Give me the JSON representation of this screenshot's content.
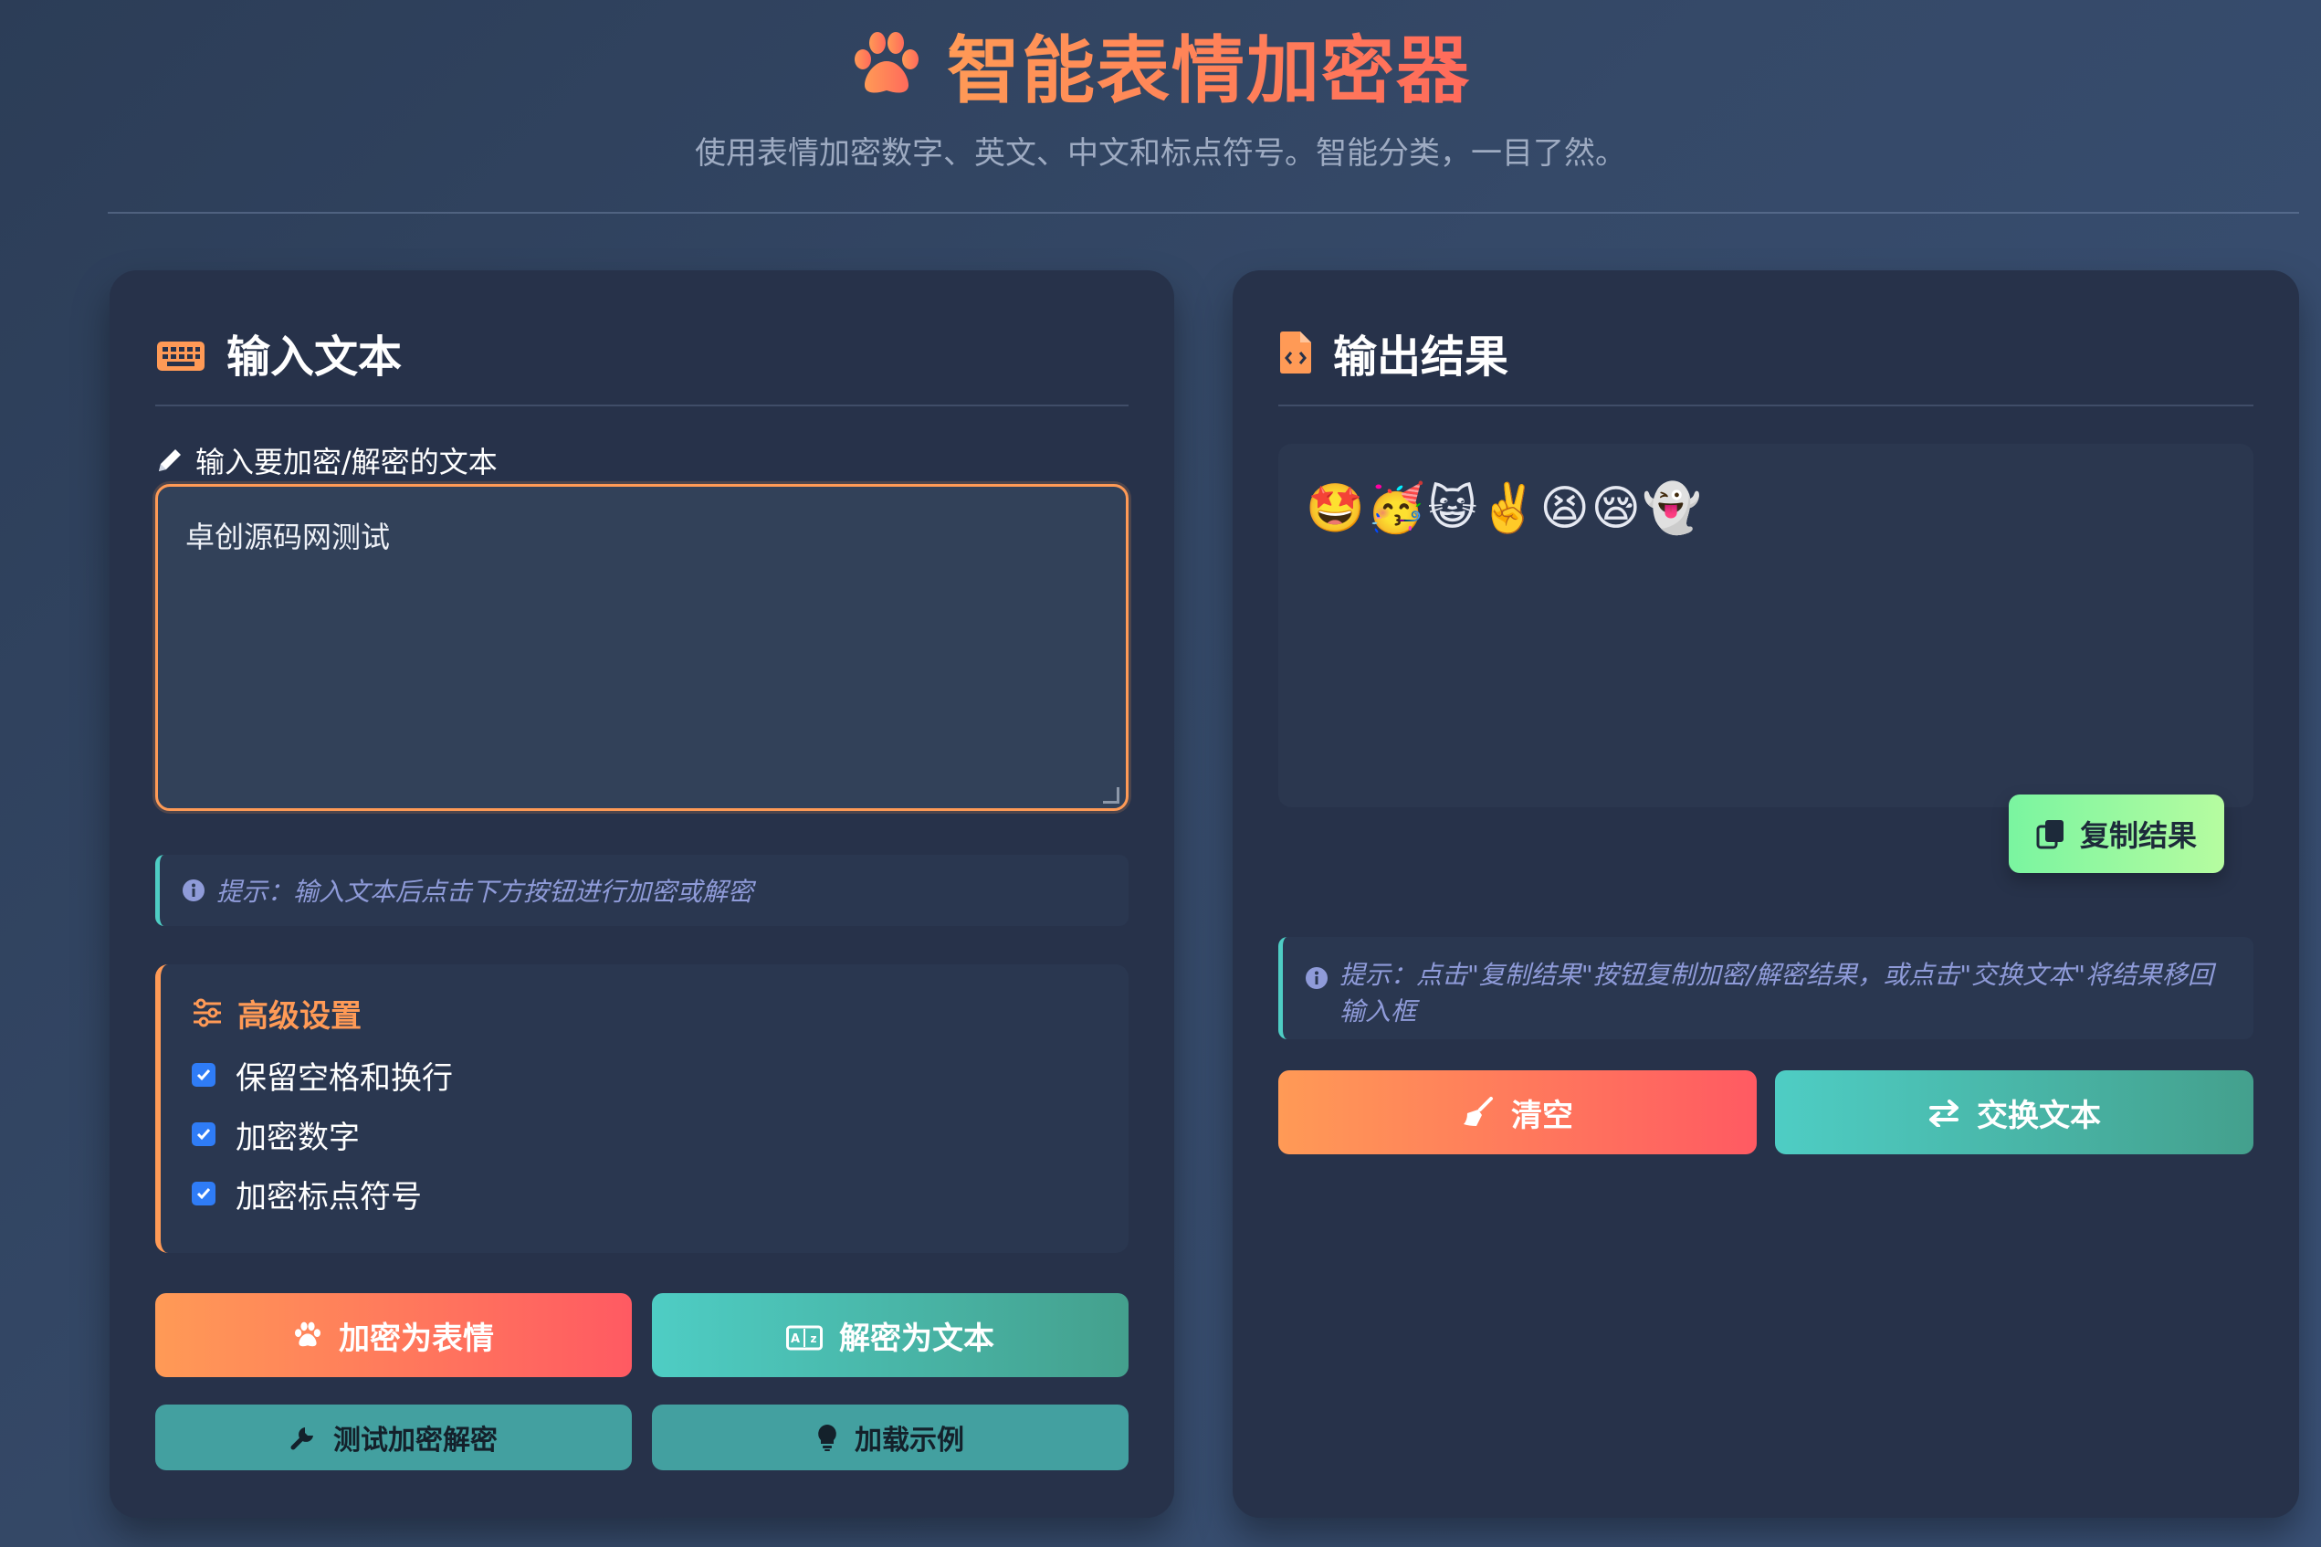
{
  "header": {
    "title": "智能表情加密器",
    "subtitle": "使用表情加密数字、英文、中文和标点符号。智能分类，一目了然。",
    "icon": "paw-icon"
  },
  "input_panel": {
    "heading": "输入文本",
    "heading_icon": "keyboard-icon",
    "field_label": "输入要加密/解密的文本",
    "field_value": "卓创源码网测试",
    "hint": "提示：输入文本后点击下方按钮进行加密或解密",
    "advanced": {
      "title": "高级设置",
      "options": [
        {
          "label": "保留空格和换行",
          "checked": true
        },
        {
          "label": "加密数字",
          "checked": true
        },
        {
          "label": "加密标点符号",
          "checked": true
        }
      ]
    },
    "buttons": {
      "encrypt": "加密为表情",
      "decrypt": "解密为文本",
      "test": "测试加密解密",
      "example": "加载示例"
    }
  },
  "output_panel": {
    "heading": "输出结果",
    "heading_icon": "file-code-icon",
    "result": "🤩🥳😺✌️😫😪👻",
    "copy_button": "复制结果",
    "hint": "提示：点击\"复制结果\"按钮复制加密/解密结果，或点击\"交换文本\"将结果移回输入框",
    "buttons": {
      "clear": "清空",
      "swap": "交换文本"
    }
  },
  "colors": {
    "accent_orange": "#ff9a56",
    "accent_red": "#ff5a62",
    "accent_teal": "#4ecdc4",
    "card_bg": "#27324a",
    "hint_text": "#8f9bd9",
    "checkbox_blue": "#2f7cf6"
  }
}
